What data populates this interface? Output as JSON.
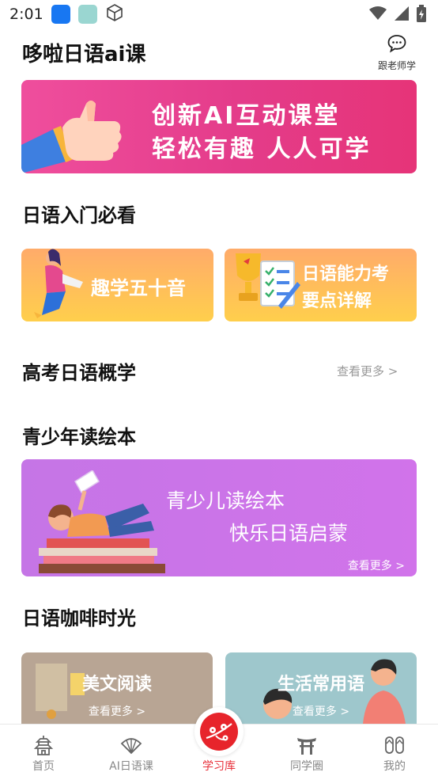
{
  "status_bar": {
    "time": "2:01"
  },
  "header": {
    "title": "哆啦日语ai课",
    "teacher_label": "跟老师学"
  },
  "hero": {
    "line1": "创新AI互动课堂",
    "line2": "轻松有趣 人人可学"
  },
  "intro": {
    "title": "日语入门必看",
    "cards": [
      {
        "label": "趣学五十音"
      },
      {
        "line1": "日语能力考",
        "line2": "要点详解"
      }
    ]
  },
  "gaokao": {
    "title": "高考日语概学",
    "more": "查看更多 >"
  },
  "kids": {
    "title": "青少年读绘本",
    "line1": "青少儿读绘本",
    "line2": "快乐日语启蒙",
    "more": "查看更多 >"
  },
  "coffee": {
    "title": "日语咖啡时光",
    "cards": [
      {
        "title": "美文阅读",
        "more": "查看更多 >"
      },
      {
        "title": "生活常用语",
        "more": "查看更多 >"
      }
    ]
  },
  "tabbar": {
    "active": "学习库",
    "accent": "#e7242b",
    "items": [
      {
        "label": "首页",
        "icon": "pagoda-icon"
      },
      {
        "label": "AI日语课",
        "icon": "fan-icon"
      },
      {
        "label": "学习库",
        "icon": "cherry-blossom-icon"
      },
      {
        "label": "同学圈",
        "icon": "torii-icon"
      },
      {
        "label": "我的",
        "icon": "sandals-icon"
      }
    ]
  }
}
